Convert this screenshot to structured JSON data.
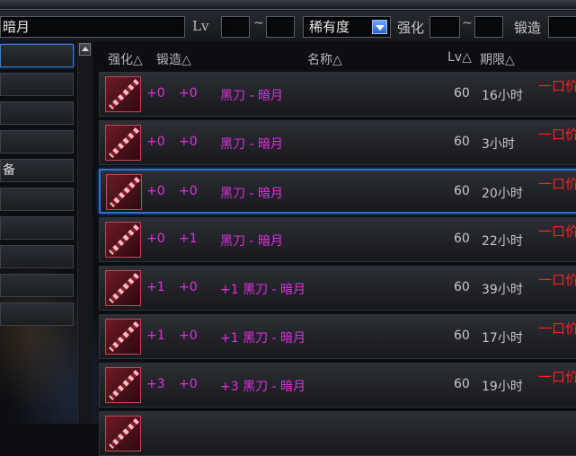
{
  "search": {
    "name_value": "暗月",
    "lv_label": "Lv",
    "tilde": "~",
    "rarity_value": "稀有度",
    "qianghua_label": "强化",
    "duanzao_label": "锻造"
  },
  "categories": [
    {
      "label": ""
    },
    {
      "label": ""
    },
    {
      "label": ""
    },
    {
      "label": ""
    },
    {
      "label": "备"
    },
    {
      "label": ""
    },
    {
      "label": ""
    },
    {
      "label": ""
    },
    {
      "label": ""
    },
    {
      "label": ""
    }
  ],
  "header": {
    "qianghua": "强化△",
    "duanzao": "锻造△",
    "name": "名称△",
    "lv": "Lv△",
    "expire": "期限△"
  },
  "rows": [
    {
      "qh": "+0",
      "dz": "+0",
      "name": "黑刀 - 暗月",
      "lv": "60",
      "time": "16小时",
      "price": "一口价"
    },
    {
      "qh": "+0",
      "dz": "+0",
      "name": "黑刀 - 暗月",
      "lv": "60",
      "time": "3小时",
      "price": "一口价"
    },
    {
      "qh": "+0",
      "dz": "+0",
      "name": "黑刀 - 暗月",
      "lv": "60",
      "time": "20小时",
      "price": "一口价"
    },
    {
      "qh": "+0",
      "dz": "+1",
      "name": "黑刀 - 暗月",
      "lv": "60",
      "time": "22小时",
      "price": "一口价"
    },
    {
      "qh": "+1",
      "dz": "+0",
      "name": "+1 黑刀 - 暗月",
      "lv": "60",
      "time": "39小时",
      "price": "一口价"
    },
    {
      "qh": "+1",
      "dz": "+0",
      "name": "+1 黑刀 - 暗月",
      "lv": "60",
      "time": "17小时",
      "price": "一口价"
    },
    {
      "qh": "+3",
      "dz": "+0",
      "name": "+3 黑刀 - 暗月",
      "lv": "60",
      "time": "19小时",
      "price": "一口价"
    }
  ],
  "colors": {
    "magenta": "#e030e0",
    "price_red": "#ff2020",
    "selection_blue": "#2f6fd1"
  },
  "selected_row_index": 2
}
